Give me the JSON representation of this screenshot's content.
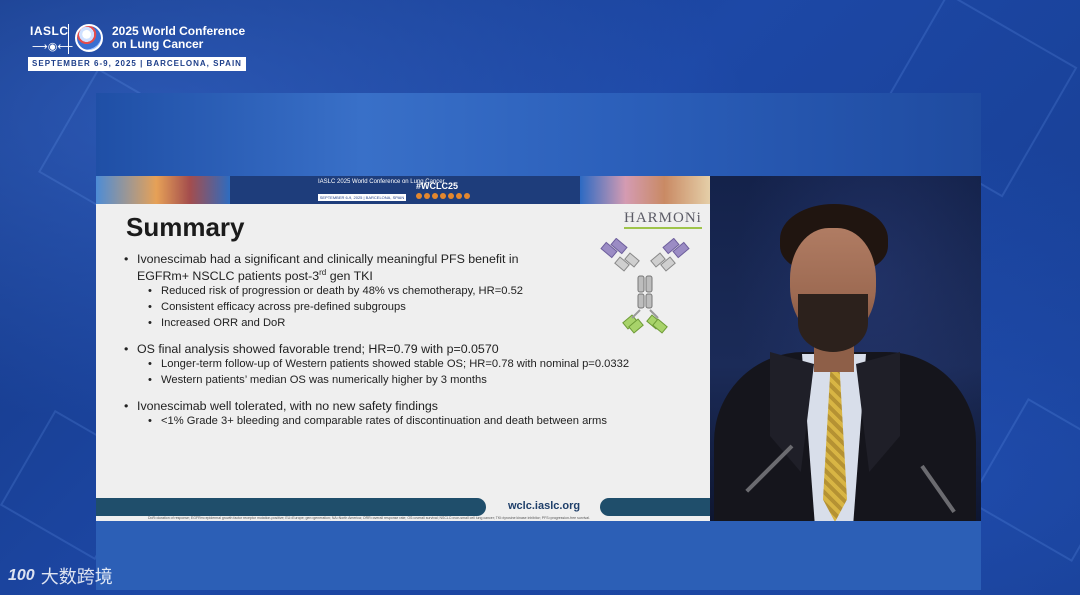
{
  "conference": {
    "org": "IASLC",
    "title_line1": "2025 World Conference",
    "title_line2": "on Lung Cancer",
    "dates": "SEPTEMBER 6-9, 2025  |  BARCELONA, SPAIN"
  },
  "slide": {
    "header": {
      "org": "IASLC",
      "title": "2025 World Conference on Lung Cancer",
      "dates": "SEPTEMBER 6-9, 2025 | BARCELONA, SPAIN",
      "hashtag": "#WCLC25"
    },
    "title": "Summary",
    "trial_logo": "HARMONi",
    "bullets": [
      {
        "text_a": "Ivonescimab had a significant and clinically meaningful PFS benefit in",
        "text_b_pre": "EGFRm+ NSCLC patients post-3",
        "text_b_sup": "rd",
        "text_b_post": " gen TKI",
        "sub": [
          "Reduced risk of progression or death by 48% vs chemotherapy, HR=0.52",
          "Consistent efficacy across pre-defined subgroups",
          "Increased ORR and DoR"
        ]
      },
      {
        "text": "OS final analysis showed favorable trend; HR=0.79 with p=0.0570",
        "sub": [
          "Longer-term follow-up of Western patients showed stable OS; HR=0.78 with nominal p=0.0332",
          "Western patients’ median OS was numerically higher by 3 months"
        ]
      },
      {
        "text": "Ivonescimab well tolerated, with no new safety findings",
        "sub": [
          "<1% Grade 3+ bleeding and comparable rates of discontinuation and death between arms"
        ]
      }
    ],
    "footer_url": "wclc.iaslc.org",
    "abbreviations": "DoR=duration of response; EGFRm=epidermal growth factor receptor mutation-positive; EU=Europe; gen=generation; NA=North America; ORR=overall response rate; OS=overall survival; NSCLC=non-small cell lung cancer; TKI=tyrosine kinase inhibitor; PFS=progression-free survival."
  },
  "watermark": {
    "logo": "100",
    "text": "大数跨境"
  },
  "colors": {
    "background": "#1a3d8f",
    "slide_bg": "#efefef",
    "slide_footer": "#1f4e6b",
    "antibody_purple": "#8d7bb8",
    "antibody_green": "#9fc44a"
  }
}
